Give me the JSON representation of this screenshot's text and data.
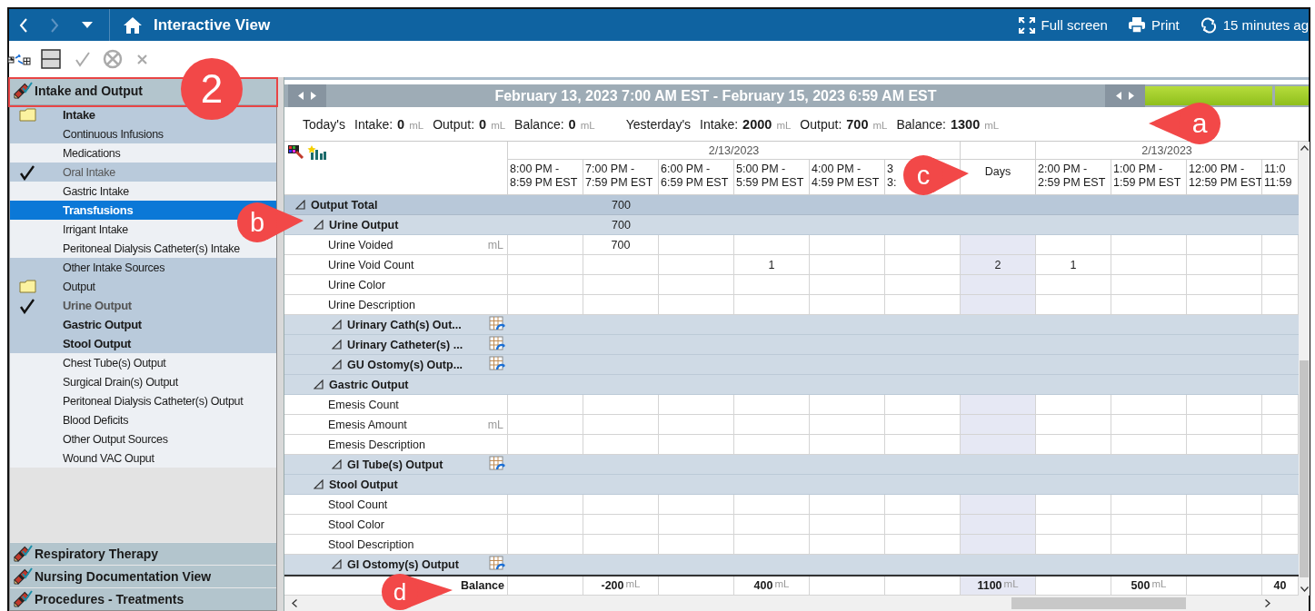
{
  "topbar": {
    "title": "Interactive View",
    "actions": [
      {
        "kind": "fullscreen",
        "label": "Full screen"
      },
      {
        "kind": "print",
        "label": "Print"
      },
      {
        "kind": "refresh",
        "label": "15 minutes ag"
      }
    ]
  },
  "sidebar": {
    "header": "Intake and Output",
    "items": [
      {
        "label": "Intake",
        "kind": "folder",
        "checked": false,
        "bold": true,
        "dimmed": false,
        "highlighted": true,
        "selected": false
      },
      {
        "label": "Continuous Infusions",
        "kind": "item",
        "checked": false,
        "bold": false,
        "dimmed": false,
        "highlighted": true,
        "selected": false
      },
      {
        "label": "Medications",
        "kind": "item",
        "checked": false,
        "bold": false,
        "dimmed": false,
        "highlighted": false,
        "selected": false
      },
      {
        "label": "Oral Intake",
        "kind": "item",
        "checked": true,
        "bold": false,
        "dimmed": true,
        "highlighted": true,
        "selected": false
      },
      {
        "label": "Gastric Intake",
        "kind": "item",
        "checked": false,
        "bold": false,
        "dimmed": false,
        "highlighted": false,
        "selected": false
      },
      {
        "label": "Transfusions",
        "kind": "item",
        "checked": false,
        "bold": true,
        "dimmed": false,
        "highlighted": false,
        "selected": true
      },
      {
        "label": "Irrigant Intake",
        "kind": "item",
        "checked": false,
        "bold": false,
        "dimmed": false,
        "highlighted": false,
        "selected": false
      },
      {
        "label": "Peritoneal Dialysis Catheter(s) Intake",
        "kind": "item",
        "checked": false,
        "bold": false,
        "dimmed": false,
        "highlighted": false,
        "selected": false
      },
      {
        "label": "Other Intake Sources",
        "kind": "item",
        "checked": false,
        "bold": false,
        "dimmed": false,
        "highlighted": true,
        "selected": false
      },
      {
        "label": "Output",
        "kind": "folder",
        "checked": false,
        "bold": false,
        "dimmed": false,
        "highlighted": true,
        "selected": false
      },
      {
        "label": "Urine Output",
        "kind": "item",
        "checked": true,
        "bold": true,
        "dimmed": true,
        "highlighted": true,
        "selected": false
      },
      {
        "label": "Gastric Output",
        "kind": "item",
        "checked": false,
        "bold": true,
        "dimmed": false,
        "highlighted": true,
        "selected": false
      },
      {
        "label": "Stool Output",
        "kind": "item",
        "checked": false,
        "bold": true,
        "dimmed": false,
        "highlighted": true,
        "selected": false
      },
      {
        "label": "Chest Tube(s) Output",
        "kind": "item",
        "checked": false,
        "bold": false,
        "dimmed": false,
        "highlighted": false,
        "selected": false
      },
      {
        "label": "Surgical Drain(s) Output",
        "kind": "item",
        "checked": false,
        "bold": false,
        "dimmed": false,
        "highlighted": false,
        "selected": false
      },
      {
        "label": "Peritoneal Dialysis Catheter(s) Output",
        "kind": "item",
        "checked": false,
        "bold": false,
        "dimmed": false,
        "highlighted": false,
        "selected": false
      },
      {
        "label": "Blood Deficits",
        "kind": "item",
        "checked": false,
        "bold": false,
        "dimmed": false,
        "highlighted": false,
        "selected": false
      },
      {
        "label": "Other Output Sources",
        "kind": "item",
        "checked": false,
        "bold": false,
        "dimmed": false,
        "highlighted": false,
        "selected": false
      },
      {
        "label": "Wound VAC Ouput",
        "kind": "item",
        "checked": false,
        "bold": false,
        "dimmed": false,
        "highlighted": false,
        "selected": false
      }
    ],
    "footer_sections": [
      "Respiratory Therapy",
      "Nursing Documentation View",
      "Procedures - Treatments"
    ]
  },
  "grid": {
    "date_range": "February 13, 2023 7:00 AM EST - February 15, 2023 6:59 AM EST",
    "summary": [
      {
        "label": "Today's",
        "values": [
          {
            "label": "Intake:",
            "value": "0",
            "unit": "mL"
          },
          {
            "label": "Output:",
            "value": "0",
            "unit": "mL"
          },
          {
            "label": "Balance:",
            "value": "0",
            "unit": "mL"
          }
        ]
      },
      {
        "label": "Yesterday's",
        "values": [
          {
            "label": "Intake:",
            "value": "2000",
            "unit": "mL"
          },
          {
            "label": "Output:",
            "value": "700",
            "unit": "mL"
          },
          {
            "label": "Balance:",
            "value": "1300",
            "unit": "mL"
          }
        ]
      }
    ],
    "column_groups": [
      {
        "date": "2/13/2023",
        "columns": [
          {
            "kind": "time",
            "line1": "8:00 PM -",
            "line2": "8:59 PM EST"
          },
          {
            "kind": "time",
            "line1": "7:00 PM -",
            "line2": "7:59 PM EST"
          },
          {
            "kind": "time",
            "line1": "6:00 PM -",
            "line2": "6:59 PM EST"
          },
          {
            "kind": "time",
            "line1": "5:00 PM -",
            "line2": "5:59 PM EST"
          },
          {
            "kind": "time",
            "line1": "4:00 PM -",
            "line2": "4:59 PM EST"
          },
          {
            "kind": "time",
            "line1": "3",
            "line2": "3:"
          }
        ]
      },
      {
        "columns": [
          {
            "kind": "days",
            "label": "Days"
          }
        ]
      },
      {
        "date": "2/13/2023",
        "columns": [
          {
            "kind": "time",
            "line1": "2:00 PM -",
            "line2": "2:59 PM EST"
          },
          {
            "kind": "time",
            "line1": "1:00 PM -",
            "line2": "1:59 PM EST"
          },
          {
            "kind": "time",
            "line1": "12:00 PM -",
            "line2": "12:59 PM EST"
          },
          {
            "kind": "time",
            "line1": "11:0",
            "line2": "11:59"
          }
        ]
      }
    ],
    "rows": [
      {
        "label": "Output Total",
        "kind": "section",
        "cells": [
          null,
          "700",
          null,
          null,
          null,
          null,
          null,
          null,
          null,
          null,
          null
        ],
        "children": [
          {
            "label": "Urine Output",
            "kind": "section",
            "cells": [
              null,
              "700",
              null,
              null,
              null,
              null,
              null,
              null,
              null,
              null,
              null
            ],
            "children": [
              {
                "label": "Urine Voided",
                "kind": "item",
                "unit": "mL",
                "cells": [
                  null,
                  "700",
                  null,
                  null,
                  null,
                  null,
                  null,
                  null,
                  null,
                  null,
                  null
                ]
              },
              {
                "label": "Urine Void Count",
                "kind": "item",
                "cells": [
                  null,
                  null,
                  null,
                  "1",
                  null,
                  null,
                  "2",
                  "1",
                  null,
                  null,
                  null
                ]
              },
              {
                "label": "Urine Color",
                "kind": "item"
              },
              {
                "label": "Urine Description",
                "kind": "item"
              },
              {
                "label": "Urinary Cath(s) Out...",
                "kind": "group"
              },
              {
                "label": "Urinary Catheter(s) ...",
                "kind": "group"
              },
              {
                "label": "GU Ostomy(s) Outp...",
                "kind": "group"
              }
            ]
          },
          {
            "label": "Gastric Output",
            "kind": "section",
            "children": [
              {
                "label": "Emesis Count",
                "kind": "item"
              },
              {
                "label": "Emesis Amount",
                "kind": "item",
                "unit": "mL"
              },
              {
                "label": "Emesis Description",
                "kind": "item"
              },
              {
                "label": "GI Tube(s) Output",
                "kind": "group"
              }
            ]
          },
          {
            "label": "Stool Output",
            "kind": "section",
            "children": [
              {
                "label": "Stool Count",
                "kind": "item"
              },
              {
                "label": "Stool Color",
                "kind": "item"
              },
              {
                "label": "Stool Description",
                "kind": "item"
              },
              {
                "label": "GI Ostomy(s) Output",
                "kind": "group"
              }
            ]
          }
        ]
      }
    ],
    "balance": {
      "label": "Balance",
      "cells": [
        null,
        {
          "value": "-200",
          "unit": "mL"
        },
        null,
        {
          "value": "400",
          "unit": "mL"
        },
        null,
        null,
        {
          "value": "1100",
          "unit": "mL"
        },
        null,
        {
          "value": "500",
          "unit": "mL"
        },
        null,
        {
          "value": "40"
        }
      ]
    }
  },
  "callouts": [
    {
      "label": "2"
    },
    {
      "label": "a"
    },
    {
      "label": "b"
    },
    {
      "label": "c"
    },
    {
      "label": "d"
    }
  ]
}
